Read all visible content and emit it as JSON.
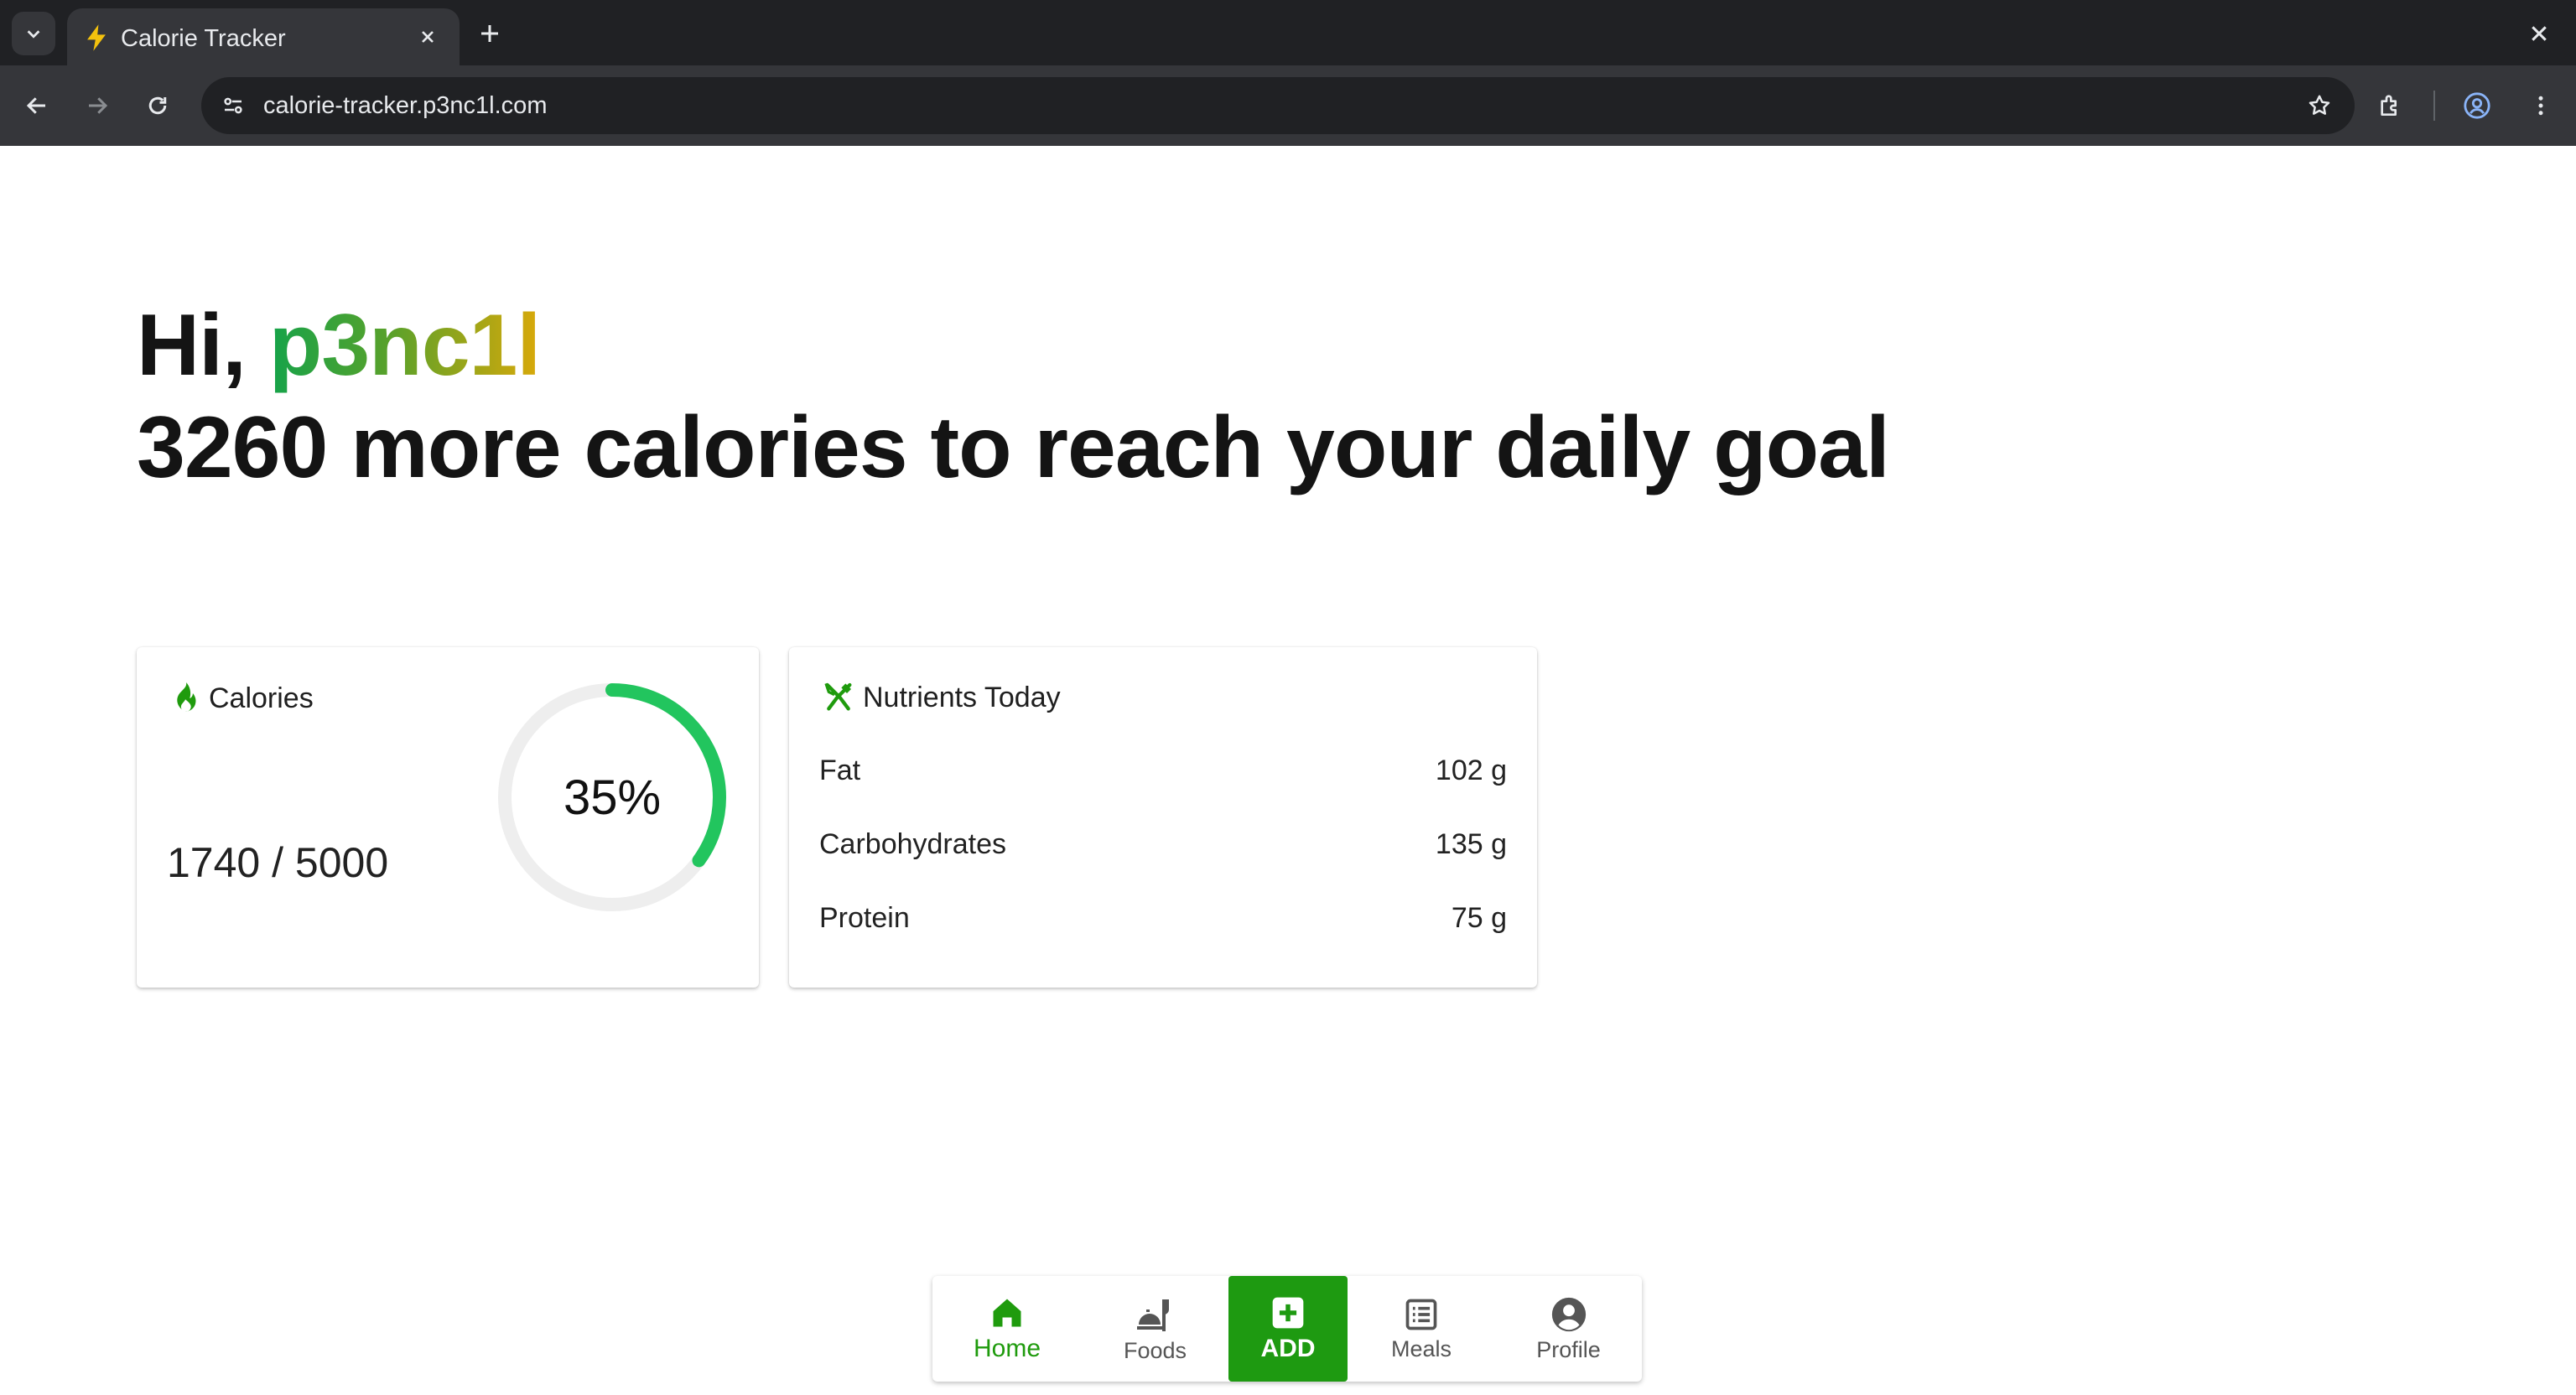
{
  "browser": {
    "tab_title": "Calorie Tracker",
    "url": "calorie-tracker.p3nc1l.com",
    "icons": [
      "tab-list-icon",
      "bolt-favicon-icon",
      "close-icon",
      "plus-icon",
      "back-icon",
      "forward-icon",
      "reload-icon",
      "site-info-icon",
      "star-icon",
      "extensions-icon",
      "profile-icon",
      "menu-icon"
    ]
  },
  "greeting": {
    "prefix": "Hi, ",
    "username": "p3nc1l",
    "headline": "3260 more calories to reach your daily goal"
  },
  "calories_card": {
    "title": "Calories",
    "value_text": "1740 / 5000",
    "percent_label": "35%",
    "progress_fraction": 0.35,
    "accent_color": "#22c55e",
    "track_color": "#eeeeee"
  },
  "nutrients_card": {
    "title": "Nutrients Today",
    "rows": [
      {
        "name": "Fat",
        "value": "102 g"
      },
      {
        "name": "Carbohydrates",
        "value": "135 g"
      },
      {
        "name": "Protein",
        "value": "75 g"
      }
    ]
  },
  "bottom_nav": {
    "home": "Home",
    "foods": "Foods",
    "add": "ADD",
    "meals": "Meals",
    "profile": "Profile",
    "active": "home",
    "active_color": "#1f9b0d"
  }
}
